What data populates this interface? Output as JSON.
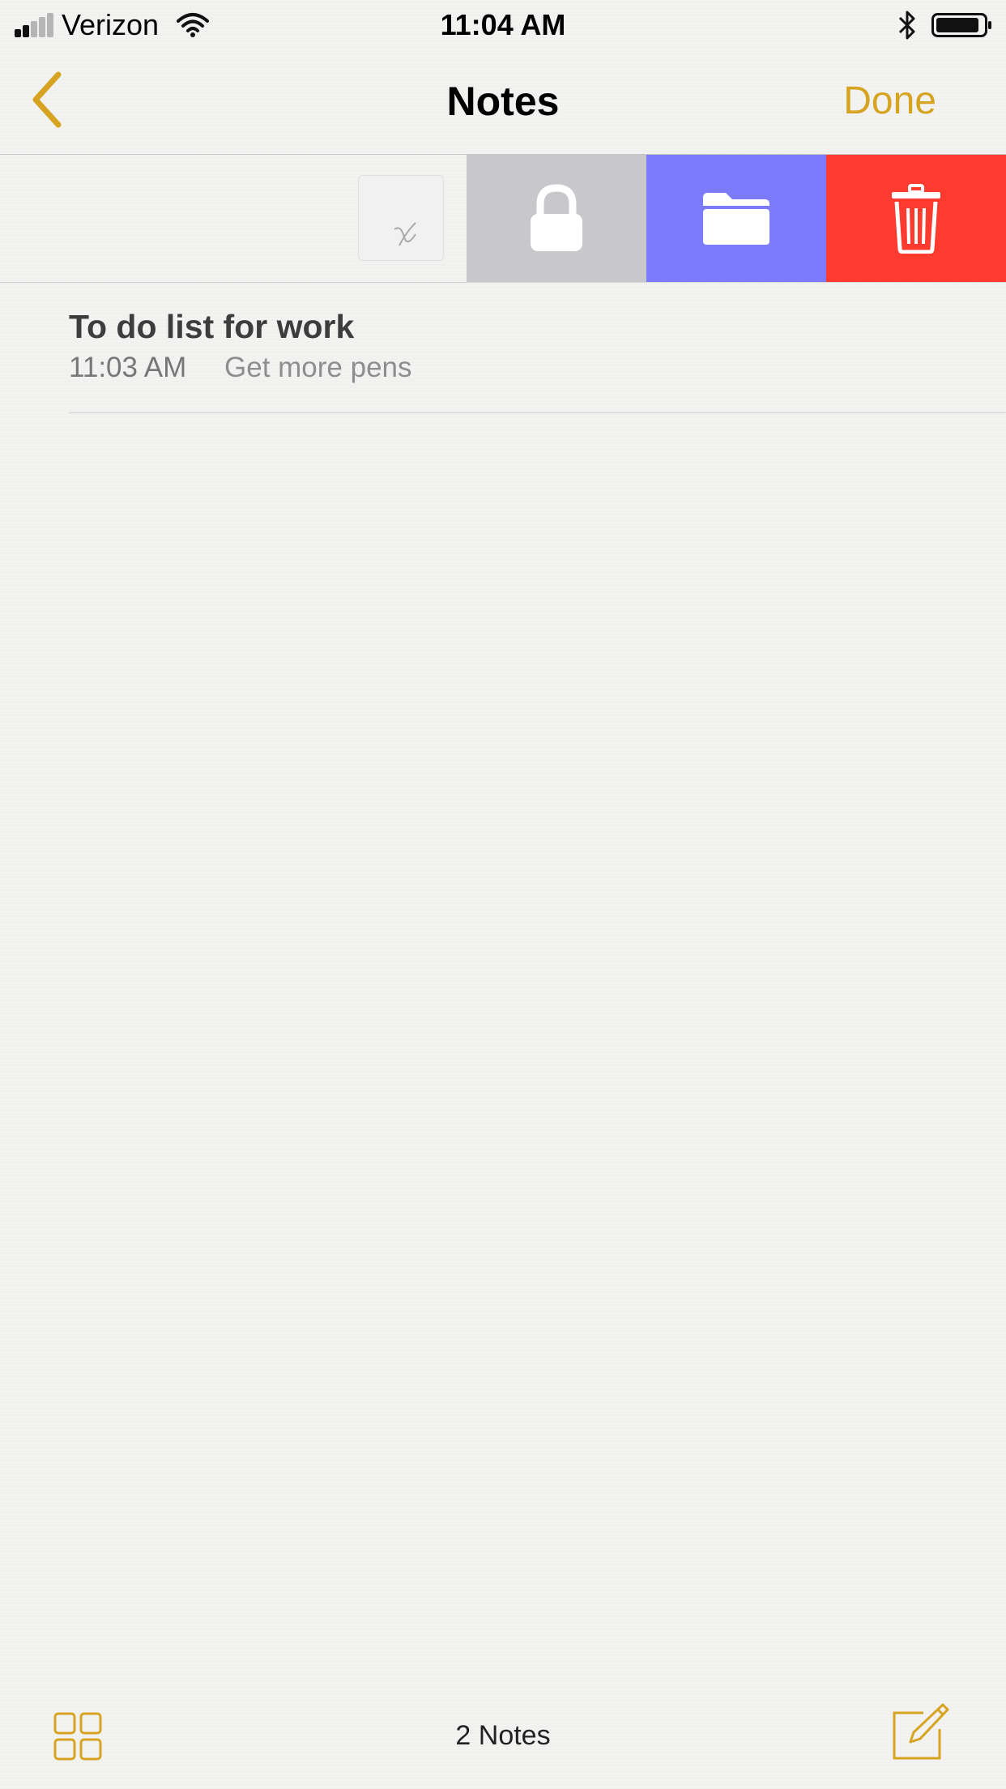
{
  "status_bar": {
    "carrier": "Verizon",
    "time": "11:04 AM",
    "icons": [
      "signal-icon",
      "wifi-icon",
      "bluetooth-icon",
      "battery-icon"
    ]
  },
  "nav": {
    "back_icon": "chevron-left-icon",
    "title": "Notes",
    "done_label": "Done"
  },
  "swiped_note": {
    "actions": [
      "lock-icon",
      "folder-icon",
      "trash-icon"
    ]
  },
  "notes": [
    {
      "title": "To do list for work",
      "time": "11:03 AM",
      "preview": "Get more pens"
    }
  ],
  "toolbar": {
    "gallery_icon": "grid-icon",
    "count_label": "2 Notes",
    "compose_icon": "compose-icon"
  },
  "colors": {
    "accent": "#d6a421",
    "lock_action": "#c7c7cc",
    "move_action": "#7b7bfc",
    "delete_action": "#ff3b30"
  }
}
